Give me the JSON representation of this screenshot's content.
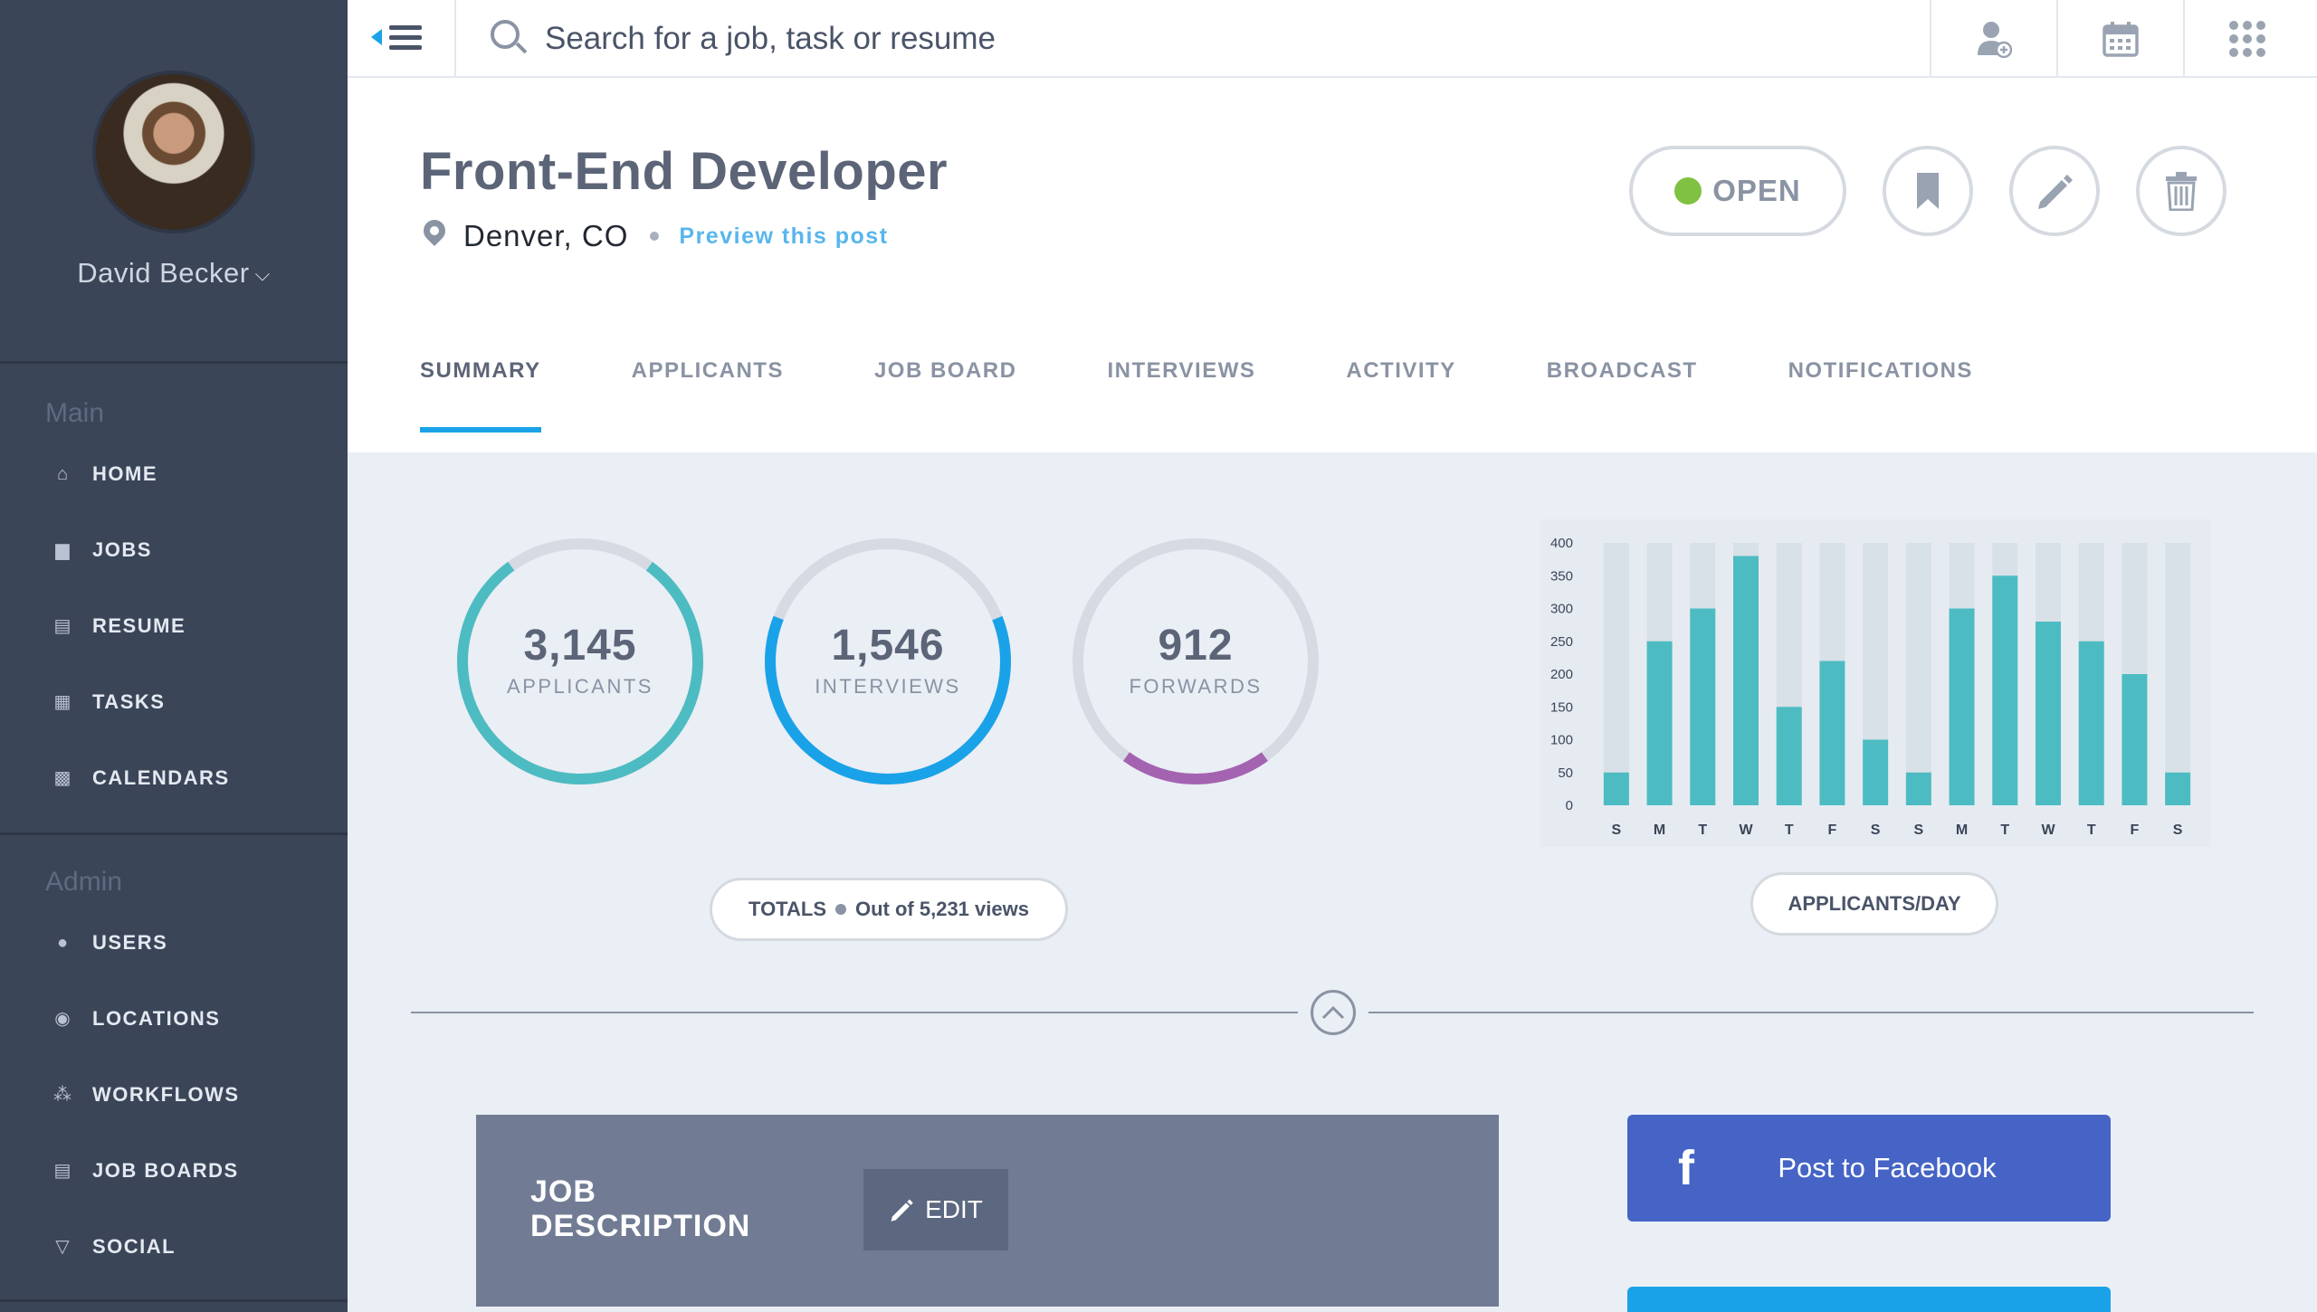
{
  "profile": {
    "name": "David Becker"
  },
  "search": {
    "placeholder": "Search for a job, task or resume"
  },
  "sidebar": {
    "main_heading": "Main",
    "main_items": [
      {
        "label": "HOME",
        "icon": "home-icon"
      },
      {
        "label": "JOBS",
        "icon": "briefcase-icon"
      },
      {
        "label": "RESUME",
        "icon": "document-icon"
      },
      {
        "label": "TASKS",
        "icon": "clipboard-icon"
      },
      {
        "label": "CALENDARS",
        "icon": "calendar-icon"
      }
    ],
    "admin_heading": "Admin",
    "admin_items": [
      {
        "label": "USERS",
        "icon": "users-icon"
      },
      {
        "label": "LOCATIONS",
        "icon": "location-pin-icon"
      },
      {
        "label": "WORKFLOWS",
        "icon": "workflow-icon"
      },
      {
        "label": "JOB BOARDS",
        "icon": "board-icon"
      },
      {
        "label": "SOCIAL",
        "icon": "social-icon"
      }
    ]
  },
  "job": {
    "title": "Front-End Developer",
    "location": "Denver, CO",
    "preview_link": "Preview this post",
    "status": "OPEN"
  },
  "tabs": [
    "SUMMARY",
    "APPLICANTS",
    "JOB BOARD",
    "INTERVIEWS",
    "ACTIVITY",
    "BROADCAST",
    "NOTIFICATIONS"
  ],
  "stats": [
    {
      "value": "3,145",
      "label": "APPLICANTS",
      "color": "#4dbcc2",
      "fraction": 0.8
    },
    {
      "value": "1,546",
      "label": "INTERVIEWS",
      "color": "#1aa2e8",
      "fraction": 0.62
    },
    {
      "value": "912",
      "label": "FORWARDS",
      "color": "#a463b0",
      "fraction": 0.2
    }
  ],
  "totals": {
    "label": "TOTALS",
    "views": "Out of 5,231 views"
  },
  "chart_data": {
    "type": "bar",
    "categories": [
      "S",
      "M",
      "T",
      "W",
      "T",
      "F",
      "S",
      "S",
      "M",
      "T",
      "W",
      "T",
      "F",
      "S"
    ],
    "values": [
      50,
      250,
      300,
      380,
      150,
      220,
      100,
      50,
      300,
      350,
      280,
      250,
      200,
      50
    ],
    "ylim": [
      0,
      400
    ],
    "yticks": [
      0,
      50,
      100,
      150,
      200,
      250,
      300,
      350,
      400
    ],
    "bar_color": "#4dbcc2",
    "track_color": "#d8e0e8",
    "caption": "APPLICANTS/DAY"
  },
  "job_description": {
    "title_line1": "JOB",
    "title_line2": "DESCRIPTION",
    "edit_label": "EDIT"
  },
  "social": {
    "facebook_label": "Post to Facebook"
  }
}
